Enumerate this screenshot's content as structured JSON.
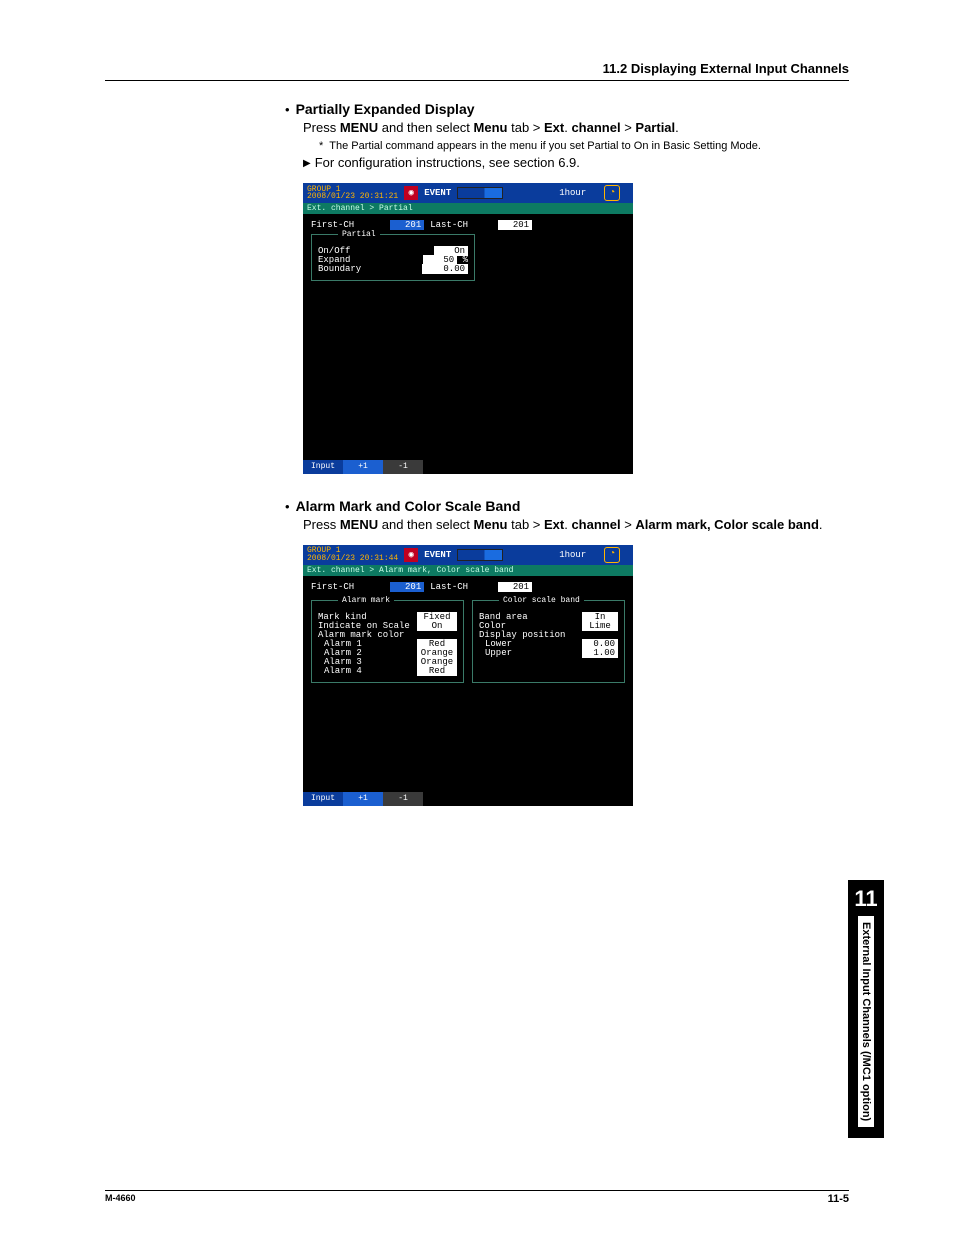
{
  "header": {
    "section_title": "11.2  Displaying External Input Channels"
  },
  "section1": {
    "title": "Partially Expanded Display",
    "press": "Press ",
    "menu_word": "MENU",
    "mid1": " and then select ",
    "menu_tab": "Menu",
    "tab_word": " tab > ",
    "ext": "Ext",
    "dot": ". ",
    "channel": "channel",
    "gt": " > ",
    "partial": "Partial",
    "end": ".",
    "note": "The Partial command appears in the menu if you set Partial to On in Basic Setting Mode.",
    "config_ref": "For configuration instructions, see section 6.9."
  },
  "screenshot1": {
    "group": "GROUP 1",
    "datetime": "2008/01/23 20:31:21",
    "event_label": "EVENT",
    "duration": "1hour",
    "breadcrumb": "Ext. channel > Partial",
    "first_ch_label": "First-CH",
    "first_ch_value": "201",
    "last_ch_label": "Last-CH",
    "last_ch_value": "201",
    "fieldset_title": "Partial",
    "onoff_label": "On/Off",
    "onoff_value": "On",
    "expand_label": "Expand",
    "expand_value": "50",
    "expand_unit": "%",
    "boundary_label": "Boundary",
    "boundary_value": "0.00",
    "footer_input": "Input",
    "footer_plus": "+1",
    "footer_minus": "-1"
  },
  "section2": {
    "title": "Alarm Mark and Color Scale Band",
    "press": "Press ",
    "menu_word": "MENU",
    "mid1": " and then select ",
    "menu_tab": "Menu",
    "tab_word": " tab > ",
    "ext": "Ext",
    "dot": ". ",
    "channel": "channel",
    "gt": " > ",
    "target": "Alarm mark, Color scale band",
    "end": "."
  },
  "screenshot2": {
    "group": "GROUP 1",
    "datetime": "2008/01/23 20:31:44",
    "event_label": "EVENT",
    "duration": "1hour",
    "breadcrumb": "Ext. channel > Alarm mark, Color scale band",
    "first_ch_label": "First-CH",
    "first_ch_value": "201",
    "last_ch_label": "Last-CH",
    "last_ch_value": "201",
    "fs1_title": "Alarm mark",
    "mark_kind_label": "Mark kind",
    "mark_kind_value": "Fixed",
    "indicate_label": "Indicate on Scale",
    "indicate_value": "On",
    "color_label": "Alarm mark color",
    "alarm1_label": "Alarm 1",
    "alarm1_value": "Red",
    "alarm2_label": "Alarm 2",
    "alarm2_value": "Orange",
    "alarm3_label": "Alarm 3",
    "alarm3_value": "Orange",
    "alarm4_label": "Alarm 4",
    "alarm4_value": "Red",
    "fs2_title": "Color scale band",
    "band_area_label": "Band area",
    "band_area_value": "In",
    "band_color_label": "Color",
    "band_color_value": "Lime",
    "disp_pos_label": "Display position",
    "lower_label": "Lower",
    "lower_value": "0.00",
    "upper_label": "Upper",
    "upper_value": "1.00",
    "footer_input": "Input",
    "footer_plus": "+1",
    "footer_minus": "-1"
  },
  "sidebar": {
    "chapter_num": "11",
    "chapter_title": "External Input Channels (/MC1 option)"
  },
  "footer": {
    "doc_id": "M-4660",
    "page": "11-5"
  }
}
